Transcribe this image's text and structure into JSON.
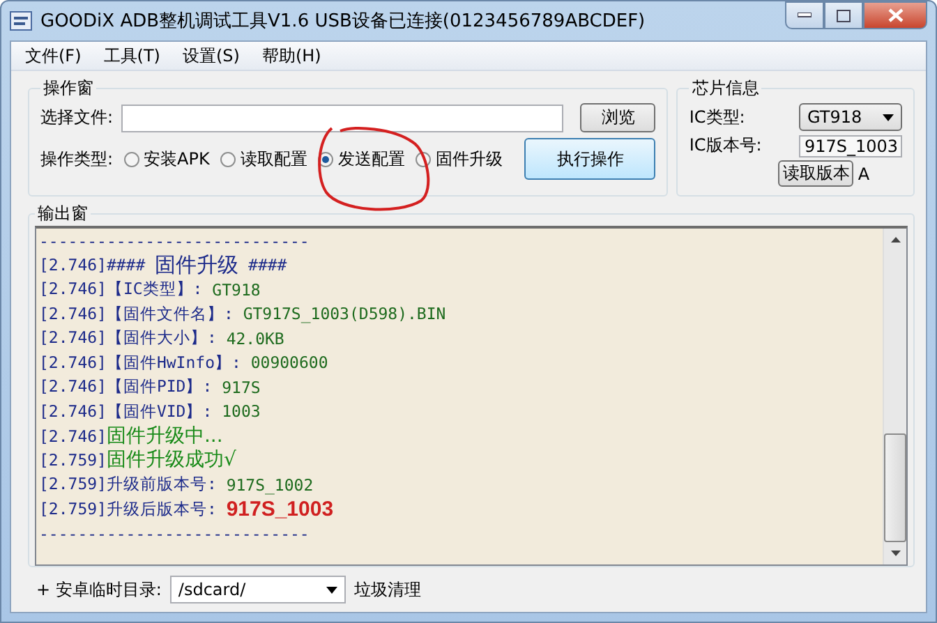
{
  "window": {
    "title": "GOODiX ADB整机调试工具V1.6 USB设备已连接(0123456789ABCDEF)"
  },
  "menu": [
    "文件(F)",
    "工具(T)",
    "设置(S)",
    "帮助(H)"
  ],
  "operation_panel": {
    "title": "操作窗",
    "file_label": "选择文件:",
    "browse_button": "浏览",
    "type_label": "操作类型:",
    "options": [
      {
        "label": "安装APK",
        "selected": false
      },
      {
        "label": "读取配置",
        "selected": false
      },
      {
        "label": "发送配置",
        "selected": true
      },
      {
        "label": "固件升级",
        "selected": false
      }
    ],
    "execute_button": "执行操作"
  },
  "chip_panel": {
    "title": "芯片信息",
    "ic_type_label": "IC类型:",
    "ic_type_value": "GT918",
    "ic_version_label": "IC版本号:",
    "ic_version_value": "917S_1003",
    "read_version_button": "读取版本",
    "suffix": "A"
  },
  "output_panel": {
    "title": "输出窗",
    "lines": [
      {
        "segments": [
          {
            "text": "----------------------------",
            "kind": "plain"
          }
        ]
      },
      {
        "segments": [
          {
            "text": "[2.746]#### ",
            "kind": "plain"
          },
          {
            "text": "固件升级",
            "kind": "heading"
          },
          {
            "text": " ####",
            "kind": "plain"
          }
        ]
      },
      {
        "segments": [
          {
            "text": "[2.746]【IC类型】: ",
            "kind": "plain"
          },
          {
            "text": "GT918",
            "kind": "value"
          }
        ]
      },
      {
        "segments": [
          {
            "text": "[2.746]【固件文件名】: ",
            "kind": "plain"
          },
          {
            "text": "GT917S_1003(D598).BIN",
            "kind": "value"
          }
        ]
      },
      {
        "segments": [
          {
            "text": "[2.746]【固件大小】: ",
            "kind": "plain"
          },
          {
            "text": "42.0KB",
            "kind": "value"
          }
        ]
      },
      {
        "segments": [
          {
            "text": "[2.746]【固件HwInfo】: ",
            "kind": "plain"
          },
          {
            "text": "00900600",
            "kind": "value"
          }
        ]
      },
      {
        "segments": [
          {
            "text": "[2.746]【固件PID】: ",
            "kind": "plain"
          },
          {
            "text": "917S",
            "kind": "value"
          }
        ]
      },
      {
        "segments": [
          {
            "text": "[2.746]【固件VID】: ",
            "kind": "plain"
          },
          {
            "text": "1003",
            "kind": "value"
          }
        ]
      },
      {
        "segments": [
          {
            "text": "[2.746]",
            "kind": "plain"
          },
          {
            "text": "固件升级中...",
            "kind": "status"
          }
        ]
      },
      {
        "segments": [
          {
            "text": "[2.759]",
            "kind": "plain"
          },
          {
            "text": "固件升级成功√",
            "kind": "status"
          }
        ]
      },
      {
        "segments": [
          {
            "text": "[2.759]升级前版本号: ",
            "kind": "plain"
          },
          {
            "text": "917S_1002",
            "kind": "value"
          }
        ]
      },
      {
        "segments": [
          {
            "text": "[2.759]升级后版本号: ",
            "kind": "plain"
          },
          {
            "text": "917S_1003",
            "kind": "highlight"
          }
        ]
      },
      {
        "segments": [
          {
            "text": "----------------------------",
            "kind": "plain"
          }
        ]
      }
    ]
  },
  "bottom_bar": {
    "dir_label": "+ 安卓临时目录:",
    "dir_value": "/sdcard/",
    "clean_label": "垃圾清理"
  }
}
